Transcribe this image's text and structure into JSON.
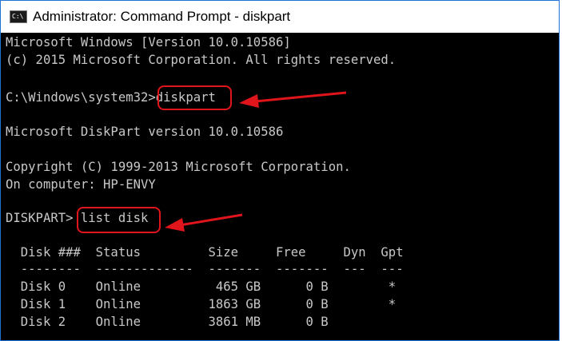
{
  "window": {
    "title": "Administrator: Command Prompt - diskpart",
    "icon": "cmd-icon",
    "icon_text": "C:\\"
  },
  "console": {
    "lines": [
      "Microsoft Windows [Version 10.0.10586]",
      "(c) 2015 Microsoft Corporation. All rights reserved.",
      "",
      "C:\\Windows\\system32>diskpart",
      "",
      "Microsoft DiskPart version 10.0.10586",
      "",
      "Copyright (C) 1999-2013 Microsoft Corporation.",
      "On computer: HP-ENVY",
      "",
      "DISKPART> list disk",
      "",
      "  Disk ###  Status         Size     Free     Dyn  Gpt",
      "  --------  -------------  -------  -------  ---  ---",
      "  Disk 0    Online          465 GB      0 B        *",
      "  Disk 1    Online         1863 GB      0 B        *",
      "  Disk 2    Online         3861 MB      0 B"
    ]
  },
  "annotations": {
    "highlight_color": "#e0141b",
    "arrow_icon": "arrow-left-icon"
  }
}
